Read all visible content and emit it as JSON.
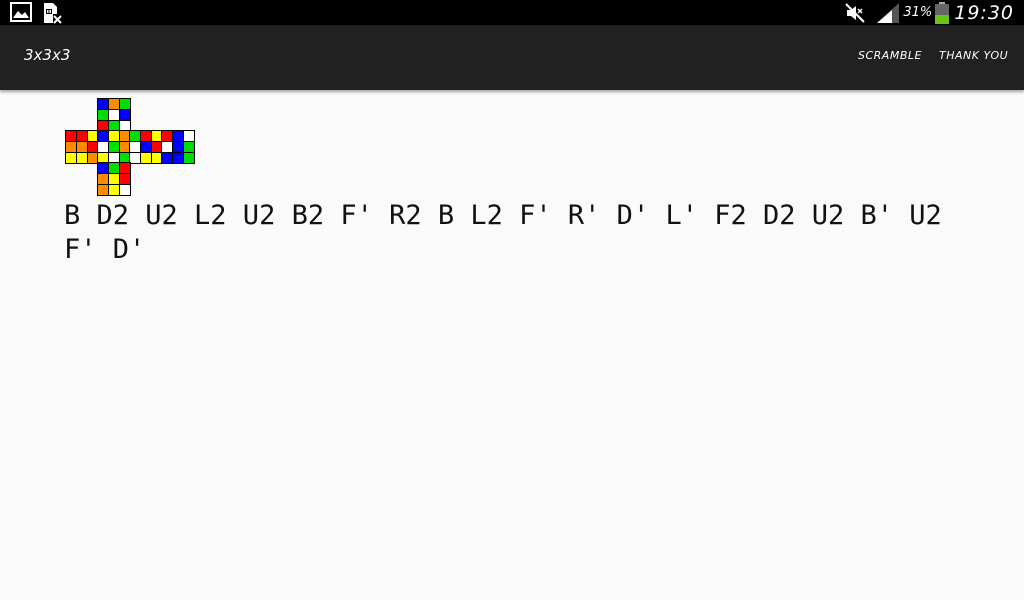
{
  "status_bar": {
    "left_icons": [
      "gallery-icon",
      "sim-off-icon"
    ],
    "right_icons": [
      "mute-icon",
      "signal-icon",
      "battery-icon"
    ],
    "battery_percent": "31%",
    "time": "19:30"
  },
  "action_bar": {
    "title": "3x3x3",
    "scramble_label": "SCRAMBLE",
    "thankyou_label": "THANK YOU"
  },
  "colors": {
    "W": "#ffffff",
    "Y": "#ffff00",
    "R": "#ff0000",
    "O": "#ff8c00",
    "B": "#0000ff",
    "G": "#00dd00"
  },
  "cube": {
    "U": [
      [
        "B",
        "O",
        "G"
      ],
      [
        "G",
        "W",
        "B"
      ],
      [
        "R",
        "G",
        "W"
      ]
    ],
    "L": [
      [
        "R",
        "R",
        "Y"
      ],
      [
        "O",
        "O",
        "R"
      ],
      [
        "Y",
        "Y",
        "O"
      ]
    ],
    "F": [
      [
        "B",
        "Y",
        "O"
      ],
      [
        "W",
        "G",
        "O"
      ],
      [
        "Y",
        "W",
        "G"
      ]
    ],
    "R": [
      [
        "G",
        "R",
        "Y"
      ],
      [
        "W",
        "B",
        "R"
      ],
      [
        "W",
        "Y",
        "Y"
      ]
    ],
    "B": [
      [
        "R",
        "B",
        "W"
      ],
      [
        "W",
        "B",
        "G"
      ],
      [
        "B",
        "B",
        "G"
      ]
    ],
    "D": [
      [
        "B",
        "G",
        "R"
      ],
      [
        "O",
        "Y",
        "R"
      ],
      [
        "O",
        "Y",
        "W"
      ]
    ]
  },
  "scramble": "B D2 U2 L2 U2 B2 F' R2 B L2 F' R' D' L' F2 D2 U2 B' U2 F' D'"
}
